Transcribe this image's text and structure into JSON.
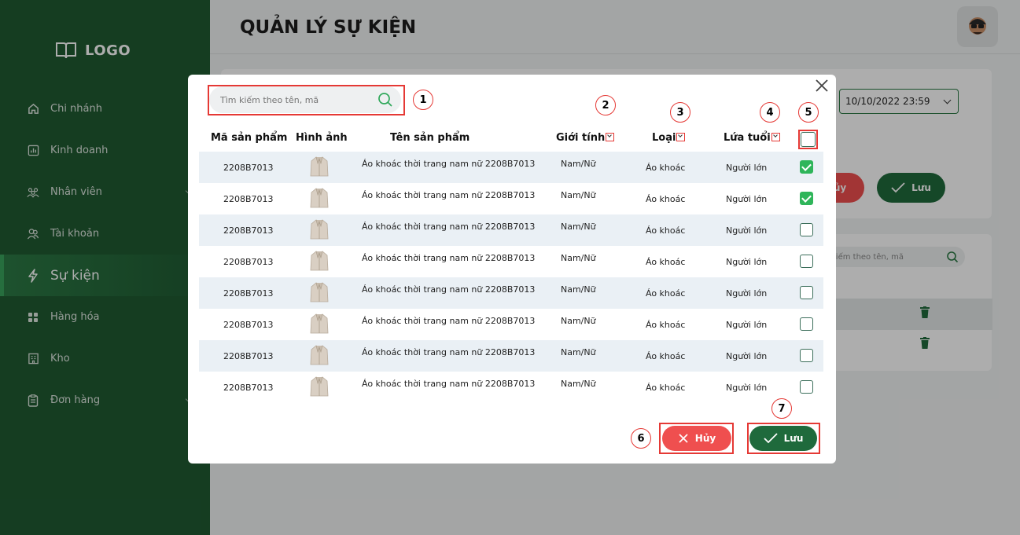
{
  "app": {
    "logo_text": "LOGO",
    "page_title": "QUẢN LÝ SỰ KIỆN"
  },
  "sidebar": {
    "items": [
      {
        "label": "Chi nhánh",
        "icon": "home-icon",
        "active": false
      },
      {
        "label": "Kinh doanh",
        "icon": "chart-icon",
        "active": false
      },
      {
        "label": "Nhân viên",
        "icon": "people-icon",
        "active": false,
        "has_submenu": true
      },
      {
        "label": "Tài khoản",
        "icon": "users-icon",
        "active": false
      },
      {
        "label": "Sự kiện",
        "icon": "lightning-icon",
        "active": true
      },
      {
        "label": "Hàng hóa",
        "icon": "grid-icon",
        "active": false
      },
      {
        "label": "Kho",
        "icon": "building-icon",
        "active": false
      },
      {
        "label": "Đơn hàng",
        "icon": "clipboard-icon",
        "active": false,
        "has_submenu": true
      }
    ]
  },
  "background": {
    "date_value": "10/10/2022 23:59",
    "cancel_label": "ủy",
    "save_label": "Lưu",
    "search_placeholder": "kiếm theo tên, mã"
  },
  "modal": {
    "search": {
      "placeholder": "Tìm kiếm theo tên, mã",
      "value": ""
    },
    "columns": {
      "code": "Mã sản phẩm",
      "image": "Hình ảnh",
      "name": "Tên sản phẩm",
      "gender": "Giới tính",
      "type": "Loại",
      "age": "Lứa tuổi"
    },
    "rows": [
      {
        "code": "2208B7013",
        "name": "Áo khoác thời trang nam nữ 2208B7013",
        "gender": "Nam/Nữ",
        "type": "Áo khoác",
        "age": "Người lớn",
        "checked": true
      },
      {
        "code": "2208B7013",
        "name": "Áo khoác thời trang nam nữ 2208B7013",
        "gender": "Nam/Nữ",
        "type": "Áo khoác",
        "age": "Người lớn",
        "checked": true
      },
      {
        "code": "2208B7013",
        "name": "Áo khoác thời trang nam nữ 2208B7013",
        "gender": "Nam/Nữ",
        "type": "Áo khoác",
        "age": "Người lớn",
        "checked": false
      },
      {
        "code": "2208B7013",
        "name": "Áo khoác thời trang nam nữ 2208B7013",
        "gender": "Nam/Nữ",
        "type": "Áo khoác",
        "age": "Người lớn",
        "checked": false
      },
      {
        "code": "2208B7013",
        "name": "Áo khoác thời trang nam nữ 2208B7013",
        "gender": "Nam/Nữ",
        "type": "Áo khoác",
        "age": "Người lớn",
        "checked": false
      },
      {
        "code": "2208B7013",
        "name": "Áo khoác thời trang nam nữ 2208B7013",
        "gender": "Nam/Nữ",
        "type": "Áo khoác",
        "age": "Người lớn",
        "checked": false
      },
      {
        "code": "2208B7013",
        "name": "Áo khoác thời trang nam nữ 2208B7013",
        "gender": "Nam/Nữ",
        "type": "Áo khoác",
        "age": "Người lớn",
        "checked": false
      },
      {
        "code": "2208B7013",
        "name": "Áo khoác thời trang nam nữ 2208B7013",
        "gender": "Nam/Nữ",
        "type": "Áo khoác",
        "age": "Người lớn",
        "checked": false
      }
    ],
    "cancel_label": "Hủy",
    "save_label": "Lưu"
  },
  "annotations": [
    "1",
    "2",
    "3",
    "4",
    "5",
    "6",
    "7"
  ],
  "colors": {
    "sidebar": "#1f5a32",
    "accent": "#2fb55a",
    "danger": "#ef4f4f",
    "save": "#1f6a3c",
    "callout": "#e53935"
  }
}
